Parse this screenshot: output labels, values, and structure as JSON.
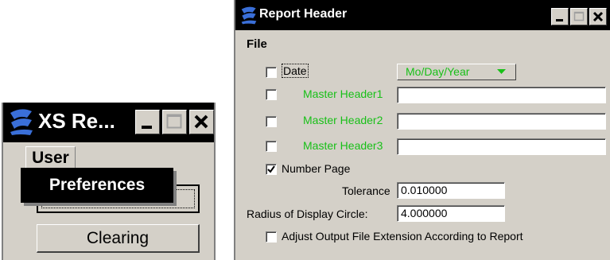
{
  "left_window": {
    "title": "XS Re...",
    "menu": {
      "user_label": "User"
    },
    "popup": {
      "item_label": "Preferences"
    },
    "buttons": {
      "clearing_label": "Clearing"
    },
    "icons": {
      "logo": "app-logo-icon",
      "minimize": "minimize-icon",
      "maximize": "maximize-icon",
      "close": "close-icon"
    }
  },
  "right_window": {
    "title": "Report Header",
    "menu": {
      "file_label": "File"
    },
    "date": {
      "label": "Date",
      "checked": false,
      "format_value": "Mo/Day/Year"
    },
    "headers": [
      {
        "label": "Master Header1",
        "checked": false,
        "value": ""
      },
      {
        "label": "Master Header2",
        "checked": false,
        "value": ""
      },
      {
        "label": "Master Header3",
        "checked": false,
        "value": ""
      }
    ],
    "number_page": {
      "label": "Number Page",
      "checked": true
    },
    "tolerance": {
      "label": "Tolerance",
      "value": "0.010000"
    },
    "radius": {
      "label": "Radius of Display Circle:",
      "value": "4.000000"
    },
    "adjust_output": {
      "label": "Adjust Output File Extension According to Report",
      "checked": false
    },
    "colors": {
      "green_label": "#18c018",
      "title_bg": "#000000",
      "dialog_bg": "#d4d0c8"
    }
  }
}
